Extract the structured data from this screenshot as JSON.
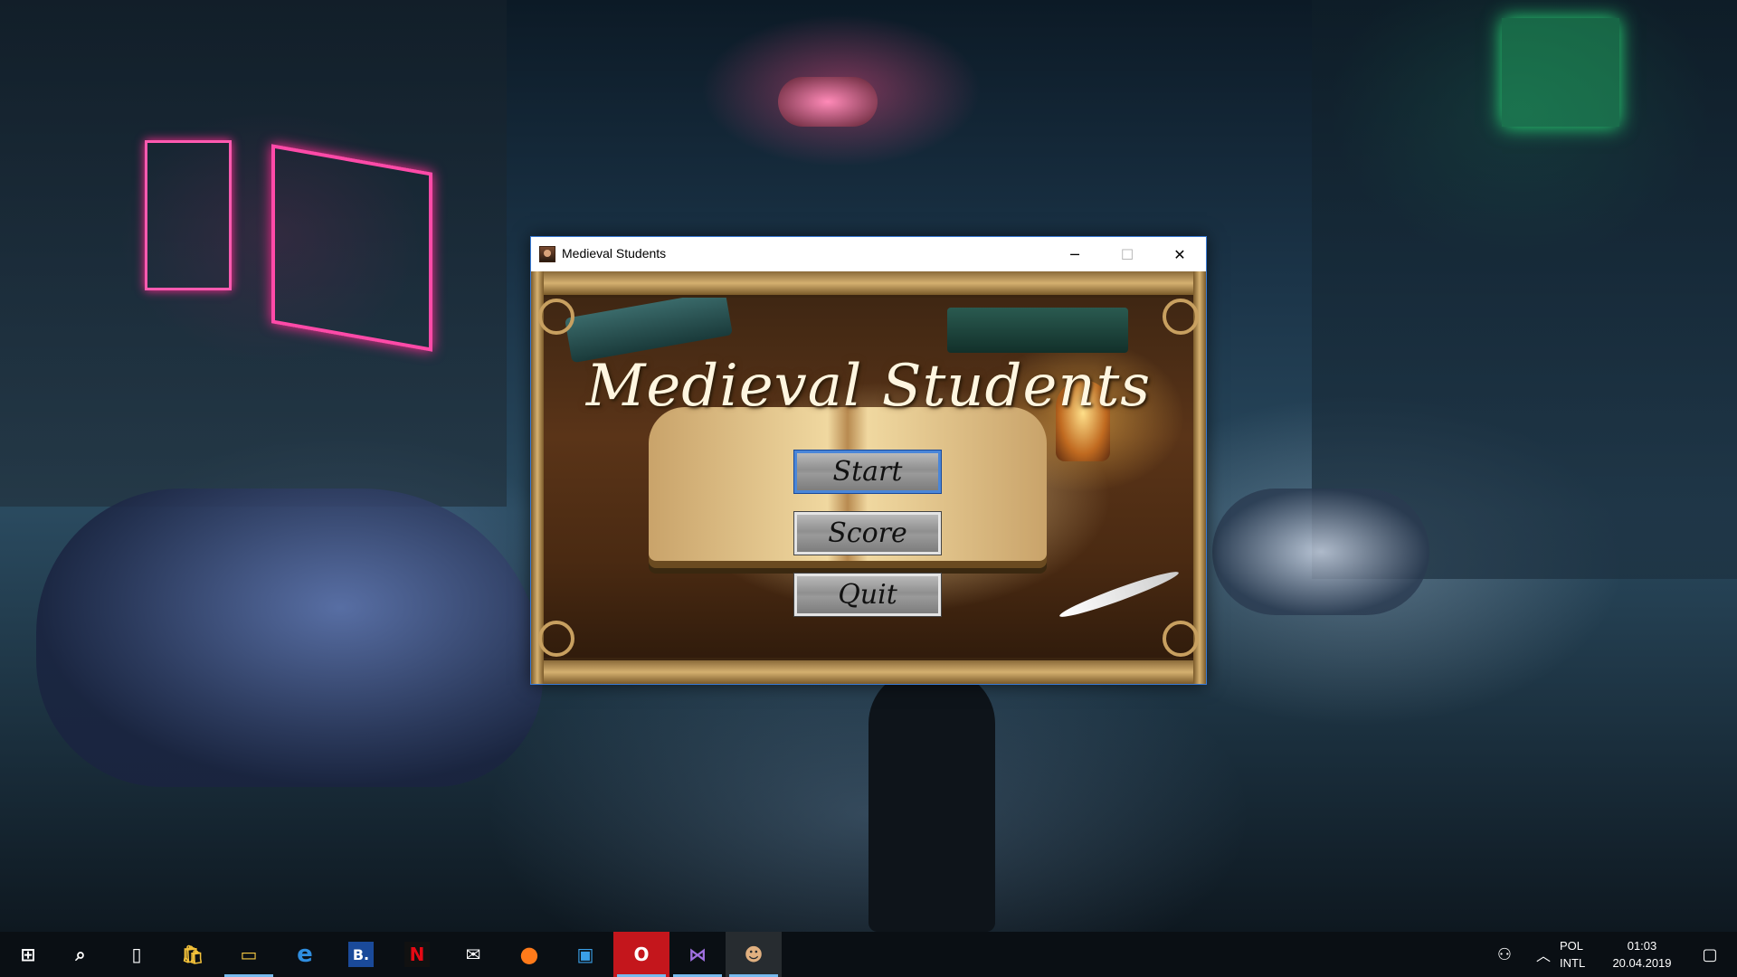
{
  "window": {
    "title": "Medieval Students",
    "minimize_glyph": "─",
    "maximize_glyph": "☐",
    "close_glyph": "✕"
  },
  "game": {
    "title": "Medieval Students",
    "menu": [
      {
        "label": "Start",
        "selected": true
      },
      {
        "label": "Score",
        "selected": false
      },
      {
        "label": "Quit",
        "selected": false
      }
    ]
  },
  "taskbar": {
    "items": [
      {
        "name": "start-menu",
        "icon": "windows-logo-icon",
        "glyph": "⊞"
      },
      {
        "name": "search",
        "icon": "search-icon",
        "glyph": "⌕"
      },
      {
        "name": "task-view",
        "icon": "task-view-icon",
        "glyph": "▯"
      },
      {
        "name": "microsoft-store",
        "icon": "store-bag-icon",
        "glyph": "🛍"
      },
      {
        "name": "file-explorer",
        "icon": "folder-icon",
        "glyph": "▭"
      },
      {
        "name": "edge",
        "icon": "edge-icon",
        "glyph": "e"
      },
      {
        "name": "booking",
        "icon": "booking-icon",
        "glyph": "B."
      },
      {
        "name": "netflix",
        "icon": "netflix-icon",
        "glyph": "N"
      },
      {
        "name": "mail",
        "icon": "mail-icon",
        "glyph": "✉"
      },
      {
        "name": "firefox",
        "icon": "firefox-icon",
        "glyph": "●"
      },
      {
        "name": "app-blue",
        "icon": "app-tile-icon",
        "glyph": "▣"
      },
      {
        "name": "opera",
        "icon": "opera-icon",
        "glyph": "O"
      },
      {
        "name": "visual-studio",
        "icon": "visual-studio-icon",
        "glyph": "⋈"
      },
      {
        "name": "medieval-students",
        "icon": "game-icon",
        "glyph": "☻"
      }
    ],
    "tray": {
      "people_glyph": "⚇",
      "chevron_glyph": "︿",
      "lang_line1": "POL",
      "lang_line2": "INTL",
      "time": "01:03",
      "date": "20.04.2019",
      "notification_glyph": "▢"
    }
  },
  "colors": {
    "accent": "#4a86d8",
    "taskbar": "#0a0f14"
  }
}
